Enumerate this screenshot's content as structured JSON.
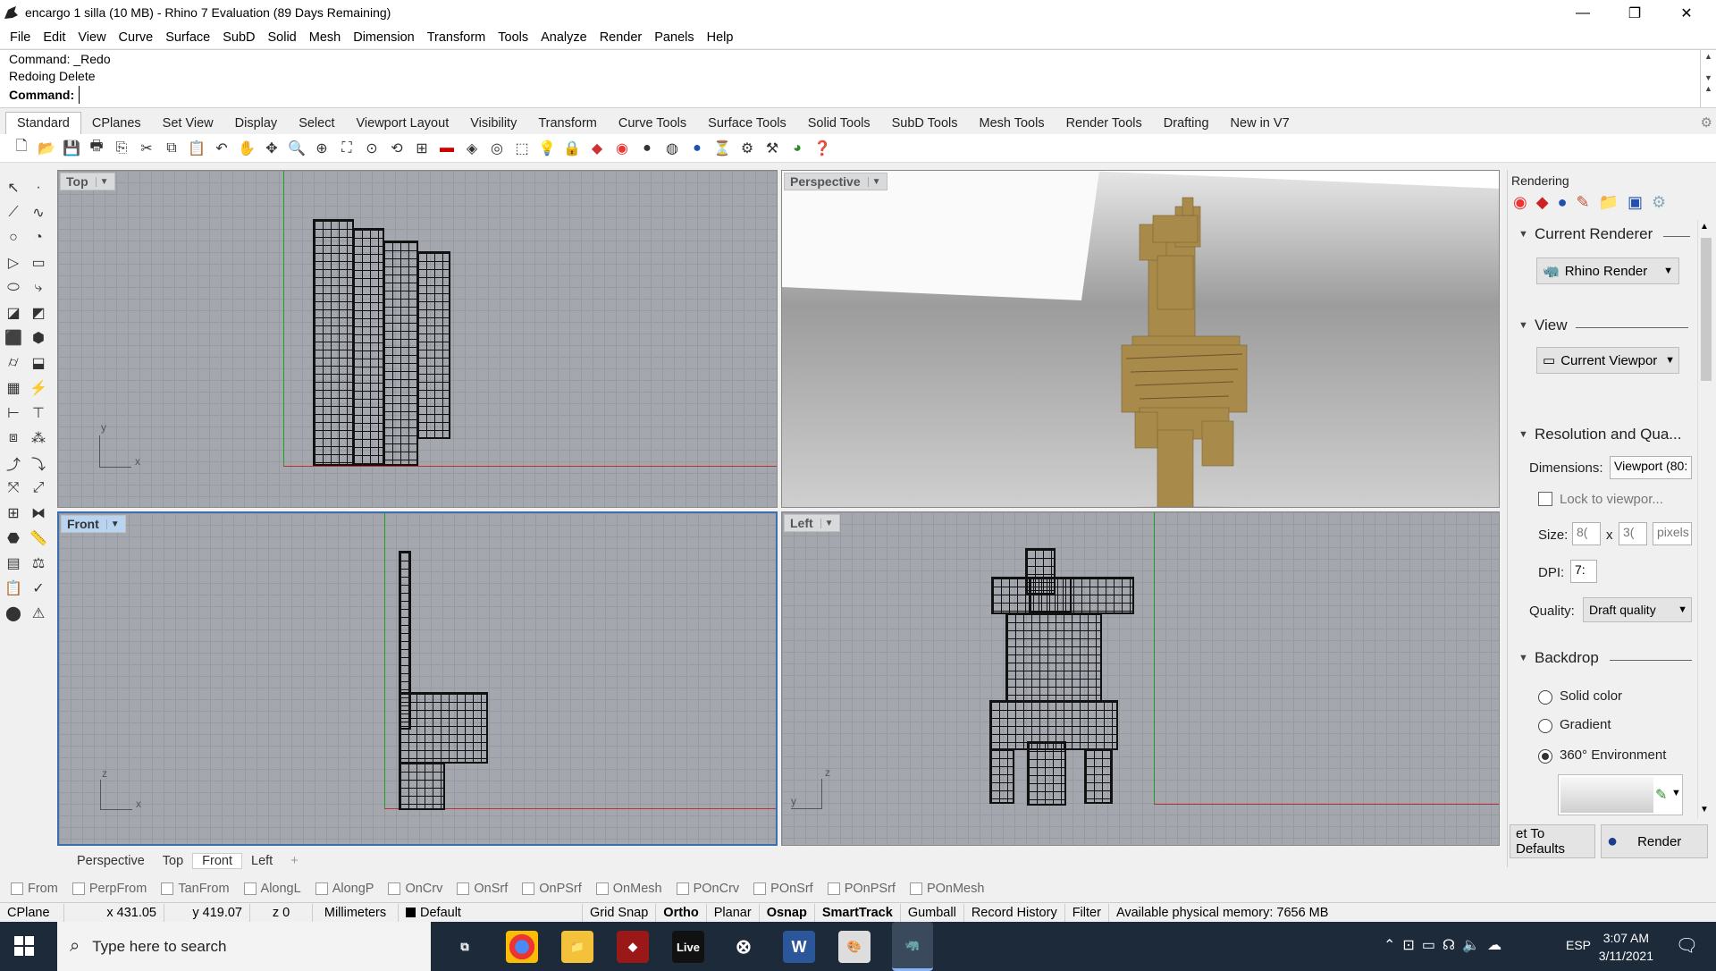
{
  "window": {
    "title": "encargo 1 silla (10 MB) - Rhino 7 Evaluation (89 Days Remaining)",
    "minimize": "—",
    "maximize": "❐",
    "close": "✕"
  },
  "menu": [
    "File",
    "Edit",
    "View",
    "Curve",
    "Surface",
    "SubD",
    "Solid",
    "Mesh",
    "Dimension",
    "Transform",
    "Tools",
    "Analyze",
    "Render",
    "Panels",
    "Help"
  ],
  "command": {
    "history": [
      "Command: _Redo",
      "Redoing Delete"
    ],
    "prompt": "Command:"
  },
  "toolbar_tabs": [
    "Standard",
    "CPlanes",
    "Set View",
    "Display",
    "Select",
    "Viewport Layout",
    "Visibility",
    "Transform",
    "Curve Tools",
    "Surface Tools",
    "Solid Tools",
    "SubD Tools",
    "Mesh Tools",
    "Render Tools",
    "Drafting",
    "New in V7"
  ],
  "active_tab": "Standard",
  "viewports": {
    "top": {
      "label": "Top",
      "x_axis": "x",
      "y_axis": "y"
    },
    "perspective": {
      "label": "Perspective"
    },
    "front": {
      "label": "Front",
      "x_axis": "x",
      "y_axis": "z"
    },
    "left": {
      "label": "Left",
      "x_axis": "y",
      "y_axis": "z"
    }
  },
  "viewport_tabs": [
    "Perspective",
    "Top",
    "Front",
    "Left",
    "+"
  ],
  "rendering_panel": {
    "title": "Rendering",
    "current_renderer": {
      "heading": "Current Renderer",
      "value": "Rhino Render"
    },
    "view": {
      "heading": "View",
      "value": "Current Viewpor"
    },
    "resolution": {
      "heading": "Resolution and Qua...",
      "dimensions_label": "Dimensions:",
      "dimensions_value": "Viewport (80:",
      "lock_label": "Lock to viewpor...",
      "size_label": "Size:",
      "size_w": "8(",
      "size_x": "x",
      "size_h": "3(",
      "size_unit": "pixels",
      "dpi_label": "DPI:",
      "dpi_value": "7:",
      "quality_label": "Quality:",
      "quality_value": "Draft quality"
    },
    "backdrop": {
      "heading": "Backdrop",
      "options": [
        "Solid color",
        "Gradient",
        "360° Environment"
      ],
      "selected": "360° Environment"
    },
    "reset_button": "et To Defaults",
    "render_button": "Render"
  },
  "osnaps": [
    "From",
    "PerpFrom",
    "TanFrom",
    "AlongL",
    "AlongP",
    "OnCrv",
    "OnSrf",
    "OnPSrf",
    "OnMesh",
    "POnCrv",
    "POnSrf",
    "POnPSrf",
    "POnMesh"
  ],
  "status": {
    "cplane": "CPlane",
    "x": "x 431.05",
    "y": "y 419.07",
    "z": "z 0",
    "units": "Millimeters",
    "layer": "Default",
    "toggles": [
      "Grid Snap",
      "Ortho",
      "Planar",
      "Osnap",
      "SmartTrack",
      "Gumball",
      "Record History",
      "Filter"
    ],
    "bold_toggles": [
      "Ortho",
      "Osnap",
      "SmartTrack"
    ],
    "memory": "Available physical memory: 7656 MB"
  },
  "taskbar": {
    "search_placeholder": "Type here to search",
    "language": "ESP",
    "time": "3:07 AM",
    "date": "3/11/2021",
    "live_label": "Live"
  },
  "colors": {
    "viewport_grid": "#a4a8ae",
    "chair_wood": "#a88a4a",
    "accent_active_viewport": "#b8d4f0",
    "taskbar": "#1c2a3a"
  }
}
